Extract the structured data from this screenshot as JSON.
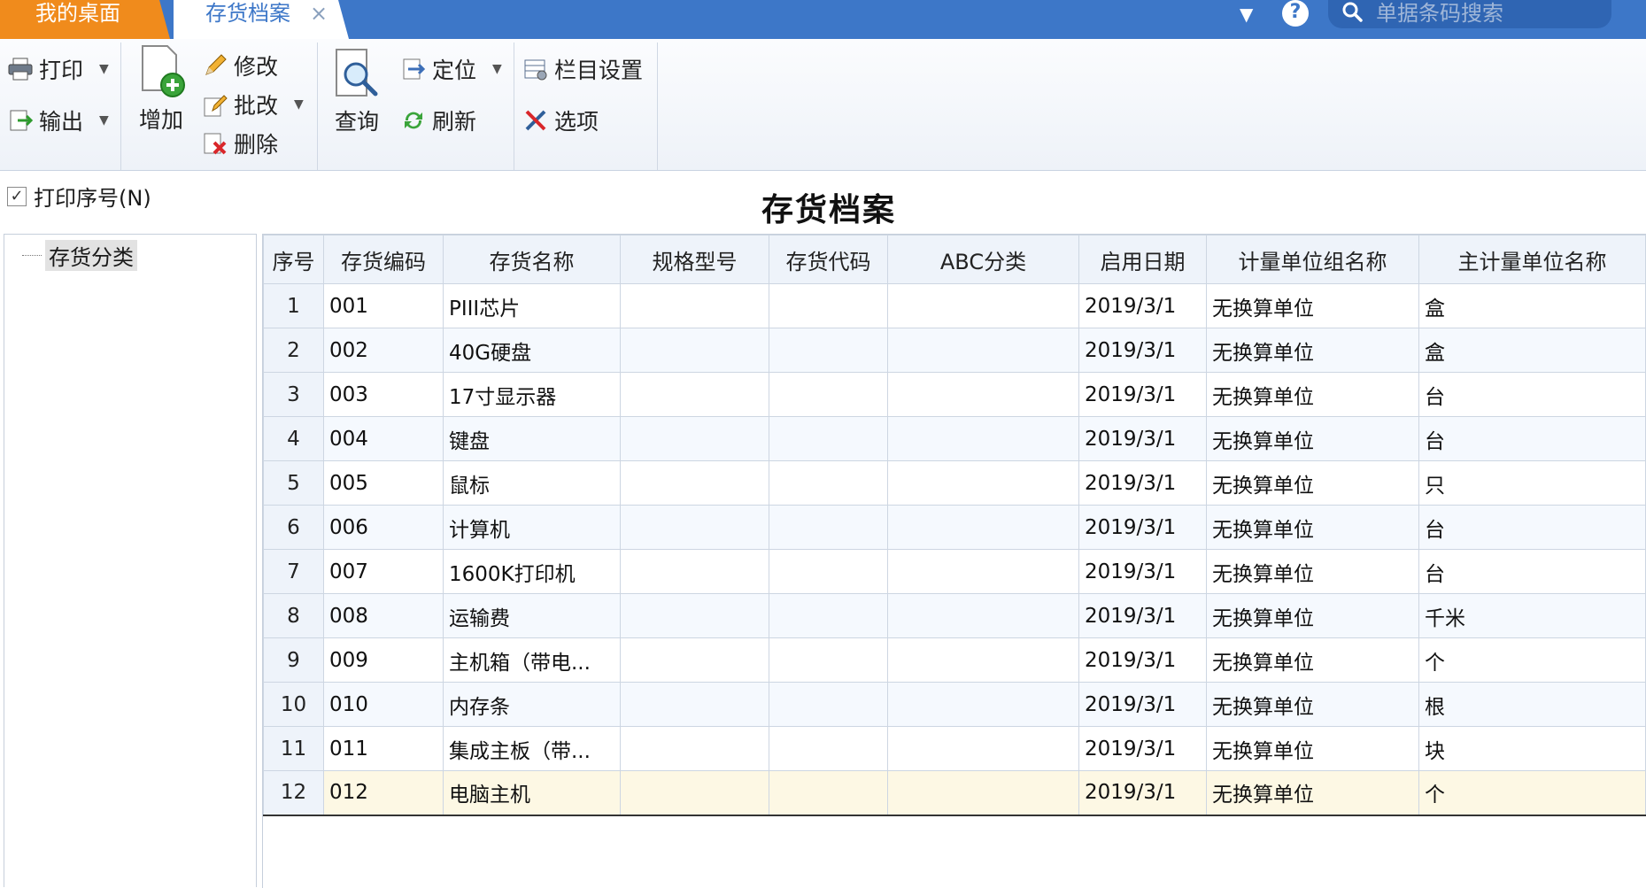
{
  "tabs": {
    "desktop": "我的桌面",
    "inventory": "存货档案",
    "close": "×"
  },
  "search": {
    "placeholder": "单据条码搜索"
  },
  "toolbar": {
    "print": "打印",
    "export": "输出",
    "add": "增加",
    "modify": "修改",
    "batch_modify": "批改",
    "delete": "删除",
    "query": "查询",
    "locate": "定位",
    "refresh": "刷新",
    "column_settings": "栏目设置",
    "options": "选项"
  },
  "print_sequence": {
    "label": "打印序号(N)",
    "checked": true
  },
  "page_title": "存货档案",
  "tree": {
    "root": "存货分类"
  },
  "grid": {
    "columns": [
      "序号",
      "存货编码",
      "存货名称",
      "规格型号",
      "存货代码",
      "ABC分类",
      "启用日期",
      "计量单位组名称",
      "主计量单位名称"
    ],
    "rows": [
      {
        "seq": "1",
        "code": "001",
        "name": "PIII芯片",
        "spec": "",
        "icode": "",
        "abc": "",
        "date": "2019/3/1",
        "unit_group": "无换算单位",
        "unit": "盒"
      },
      {
        "seq": "2",
        "code": "002",
        "name": "40G硬盘",
        "spec": "",
        "icode": "",
        "abc": "",
        "date": "2019/3/1",
        "unit_group": "无换算单位",
        "unit": "盒"
      },
      {
        "seq": "3",
        "code": "003",
        "name": "17寸显示器",
        "spec": "",
        "icode": "",
        "abc": "",
        "date": "2019/3/1",
        "unit_group": "无换算单位",
        "unit": "台"
      },
      {
        "seq": "4",
        "code": "004",
        "name": "键盘",
        "spec": "",
        "icode": "",
        "abc": "",
        "date": "2019/3/1",
        "unit_group": "无换算单位",
        "unit": "台"
      },
      {
        "seq": "5",
        "code": "005",
        "name": "鼠标",
        "spec": "",
        "icode": "",
        "abc": "",
        "date": "2019/3/1",
        "unit_group": "无换算单位",
        "unit": "只"
      },
      {
        "seq": "6",
        "code": "006",
        "name": "计算机",
        "spec": "",
        "icode": "",
        "abc": "",
        "date": "2019/3/1",
        "unit_group": "无换算单位",
        "unit": "台"
      },
      {
        "seq": "7",
        "code": "007",
        "name": "1600K打印机",
        "spec": "",
        "icode": "",
        "abc": "",
        "date": "2019/3/1",
        "unit_group": "无换算单位",
        "unit": "台"
      },
      {
        "seq": "8",
        "code": "008",
        "name": "运输费",
        "spec": "",
        "icode": "",
        "abc": "",
        "date": "2019/3/1",
        "unit_group": "无换算单位",
        "unit": "千米"
      },
      {
        "seq": "9",
        "code": "009",
        "name": "主机箱（带电...",
        "spec": "",
        "icode": "",
        "abc": "",
        "date": "2019/3/1",
        "unit_group": "无换算单位",
        "unit": "个"
      },
      {
        "seq": "10",
        "code": "010",
        "name": "内存条",
        "spec": "",
        "icode": "",
        "abc": "",
        "date": "2019/3/1",
        "unit_group": "无换算单位",
        "unit": "根"
      },
      {
        "seq": "11",
        "code": "011",
        "name": "集成主板（带...",
        "spec": "",
        "icode": "",
        "abc": "",
        "date": "2019/3/1",
        "unit_group": "无换算单位",
        "unit": "块"
      },
      {
        "seq": "12",
        "code": "012",
        "name": "电脑主机",
        "spec": "",
        "icode": "",
        "abc": "",
        "date": "2019/3/1",
        "unit_group": "无换算单位",
        "unit": "个"
      }
    ],
    "selected_row": 12
  },
  "colors": {
    "topbar": "#3d77c8",
    "desktop_tab": "#f08b1c",
    "selected_row": "#fdf8e4"
  },
  "icons": {
    "print": "printer-icon",
    "export": "export-icon",
    "add": "add-document-icon",
    "modify": "pencil-icon",
    "batch_modify": "batch-edit-icon",
    "delete": "delete-icon",
    "query": "magnifier-document-icon",
    "locate": "locate-icon",
    "refresh": "refresh-icon",
    "column_settings": "column-settings-icon",
    "options": "tools-icon",
    "help": "help-icon",
    "search": "search-icon"
  }
}
